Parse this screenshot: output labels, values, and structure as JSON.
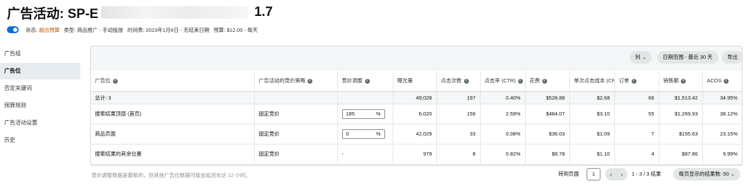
{
  "header": {
    "title_prefix": "广告活动: SP-E",
    "title_suffix": " 1.7"
  },
  "meta": {
    "status_label": "状态:",
    "status_value": "超出预算",
    "type": "类型: 商品推广 - 手动投放",
    "dates": "时间表: 2023年1月6日 - 无结束日期",
    "budget": "预算: $12.00 - 每天"
  },
  "sidebar": {
    "items": [
      {
        "label": "广告组"
      },
      {
        "label": "广告位"
      },
      {
        "label": "否定关键词"
      },
      {
        "label": "预算规则"
      },
      {
        "label": "广告活动设置"
      },
      {
        "label": "历史"
      }
    ]
  },
  "toolbar": {
    "columns": "列",
    "date_range": "日期范围 - 最近 30 天",
    "export": "导出"
  },
  "table": {
    "headers": [
      "广告位",
      "广告活动的竞价策略",
      "竞价调整",
      "曝光量",
      "点击次数",
      "点击率 (CTR)",
      "花费",
      "单次点击成本 (CP(",
      "订单",
      "销售额",
      "ACOS"
    ],
    "total": {
      "label": "总计: 3",
      "impressions": "49,028",
      "clicks": "197",
      "ctr": "0.40%",
      "spend": "$528.88",
      "cpc": "$2.68",
      "orders": "66",
      "sales": "$1,513.42",
      "acos": "34.95%"
    },
    "rows": [
      {
        "placement": "搜索结果顶部 (首页)",
        "strategy": "固定竞价",
        "adj": "185",
        "adj_unit": "%",
        "impressions": "6,020",
        "clicks": "156",
        "ctr": "2.59%",
        "spend": "$484.07",
        "cpc": "$3.10",
        "orders": "55",
        "sales": "$1,269.93",
        "acos": "38.12%"
      },
      {
        "placement": "商品页面",
        "strategy": "固定竞价",
        "adj": "0",
        "adj_unit": "%",
        "impressions": "42,029",
        "clicks": "33",
        "ctr": "0.08%",
        "spend": "$36.03",
        "cpc": "$1.09",
        "orders": "7",
        "sales": "$155.63",
        "acos": "23.15%"
      },
      {
        "placement": "搜索结果的其余位置",
        "strategy": "固定竞价",
        "adj": "-",
        "impressions": "979",
        "clicks": "8",
        "ctr": "0.82%",
        "spend": "$8.78",
        "cpc": "$1.10",
        "orders": "4",
        "sales": "$87.86",
        "acos": "9.99%"
      }
    ]
  },
  "footer": {
    "note": "竞价调整数据是最新的，但其他广告位数据可能会延迟长达 12 小时。",
    "goto": "转到页面",
    "page": "1",
    "range": "1 - 3 / 3 结果",
    "per_page": "每页显示的结果数: 50"
  }
}
